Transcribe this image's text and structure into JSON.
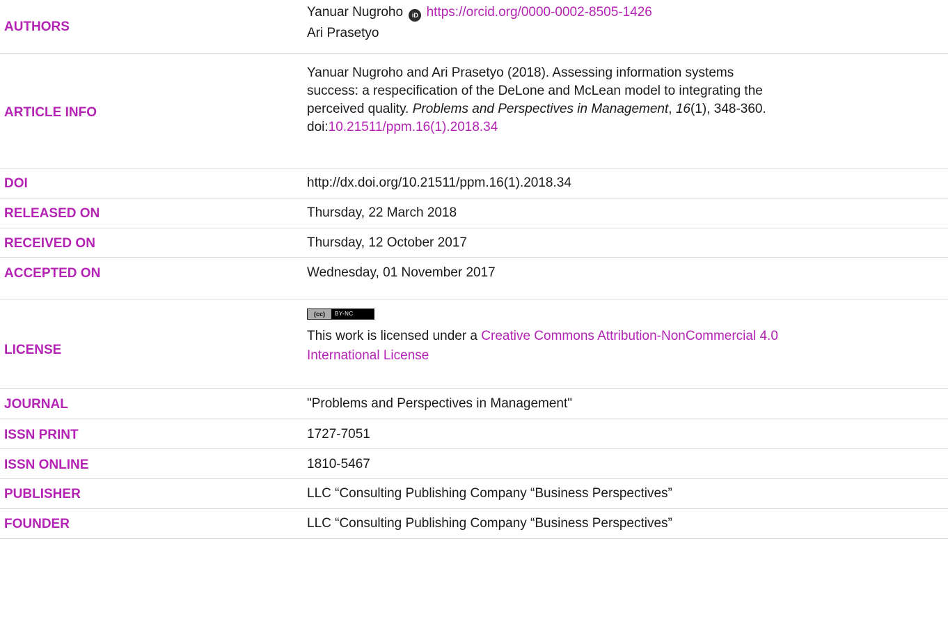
{
  "rows": {
    "authors": {
      "label": "AUTHORS",
      "author1": "Yanuar Nugroho",
      "orcid_icon": "orcid-icon",
      "orcid_url": "https://orcid.org/0000-0002-8505-1426",
      "author2": "Ari Prasetyo"
    },
    "article_info": {
      "label": "ARTICLE INFO",
      "line1": "Yanuar Nugroho and Ari Prasetyo (2018). Assessing information systems",
      "line2": "success: a respecification of the DeLone and McLean model to integrating the",
      "line3_pre": "perceived quality. ",
      "journal_italic": "Problems and Perspectives in Management",
      "comma1": ", ",
      "volume_italic": "16",
      "line3_post": "(1), 348-360.",
      "doi_prefix": "doi:",
      "doi_link": "10.21511/ppm.16(1).2018.34"
    },
    "doi": {
      "label": "DOI",
      "value": "http://dx.doi.org/10.21511/ppm.16(1).2018.34"
    },
    "released": {
      "label": "RELEASED ON",
      "value": "Thursday, 22 March 2018"
    },
    "received": {
      "label": "RECEIVED ON",
      "value": "Thursday, 12 October 2017"
    },
    "accepted": {
      "label": "ACCEPTED ON",
      "value": "Wednesday, 01 November 2017"
    },
    "license": {
      "label": "LICENSE",
      "badge_left": "(cc)",
      "badge_right": "BY-NC",
      "text": "This work is licensed under a ",
      "link_line1": "Creative Commons Attribution-NonCommercial 4.0",
      "link_line2": "International License"
    },
    "journal": {
      "label": "JOURNAL",
      "value": "\"Problems and Perspectives in Management\""
    },
    "issn_print": {
      "label": "ISSN PRINT",
      "value": "1727-7051"
    },
    "issn_online": {
      "label": "ISSN ONLINE",
      "value": "1810-5467"
    },
    "publisher": {
      "label": "PUBLISHER",
      "value": "LLC “Consulting Publishing Company “Business Perspectives”"
    },
    "founder": {
      "label": "FOUNDER",
      "value": "LLC “Consulting Publishing Company “Business Perspectives”"
    }
  },
  "colors": {
    "label": "#b423b4",
    "link": "#b423b4",
    "text": "#1a1a1a",
    "rule": "#d9d9d9"
  }
}
